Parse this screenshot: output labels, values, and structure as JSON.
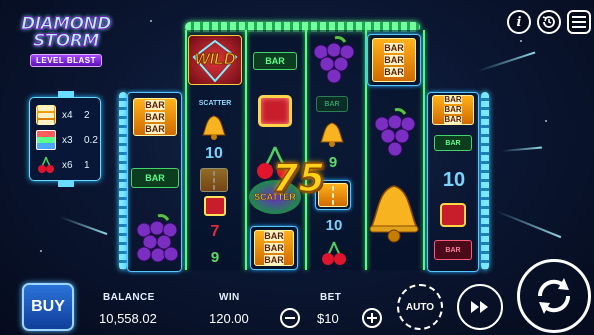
{
  "logo": {
    "line1": "DIAMOND",
    "line2": "STORM",
    "line3": "LEVEL BLAST"
  },
  "paytable": [
    {
      "symbol": "triple-bar",
      "multiplier": "x4",
      "payout": "2"
    },
    {
      "symbol": "triple-bar-colored",
      "multiplier": "x3",
      "payout": "0.2"
    },
    {
      "symbol": "cherries",
      "multiplier": "x6",
      "payout": "1"
    }
  ],
  "reels": {
    "win_amount": "75",
    "symbols": {
      "wild": "WILD",
      "scatter": "SCATTER",
      "bar": "BAR"
    }
  },
  "hud": {
    "buy_label": "BUY",
    "balance_label": "BALANCE",
    "balance_value": "10,558.02",
    "win_label": "WIN",
    "win_value": "120.00",
    "bet_label": "BET",
    "bet_value": "$10",
    "auto_label": "AUTO"
  },
  "top_controls": [
    "info-icon",
    "history-icon",
    "menu-icon"
  ],
  "colors": {
    "reel_border": "#57ff7a",
    "win_text": "#ffd21a",
    "frame_blue": "#58c6ff",
    "buy_button": "#2b73d8"
  }
}
